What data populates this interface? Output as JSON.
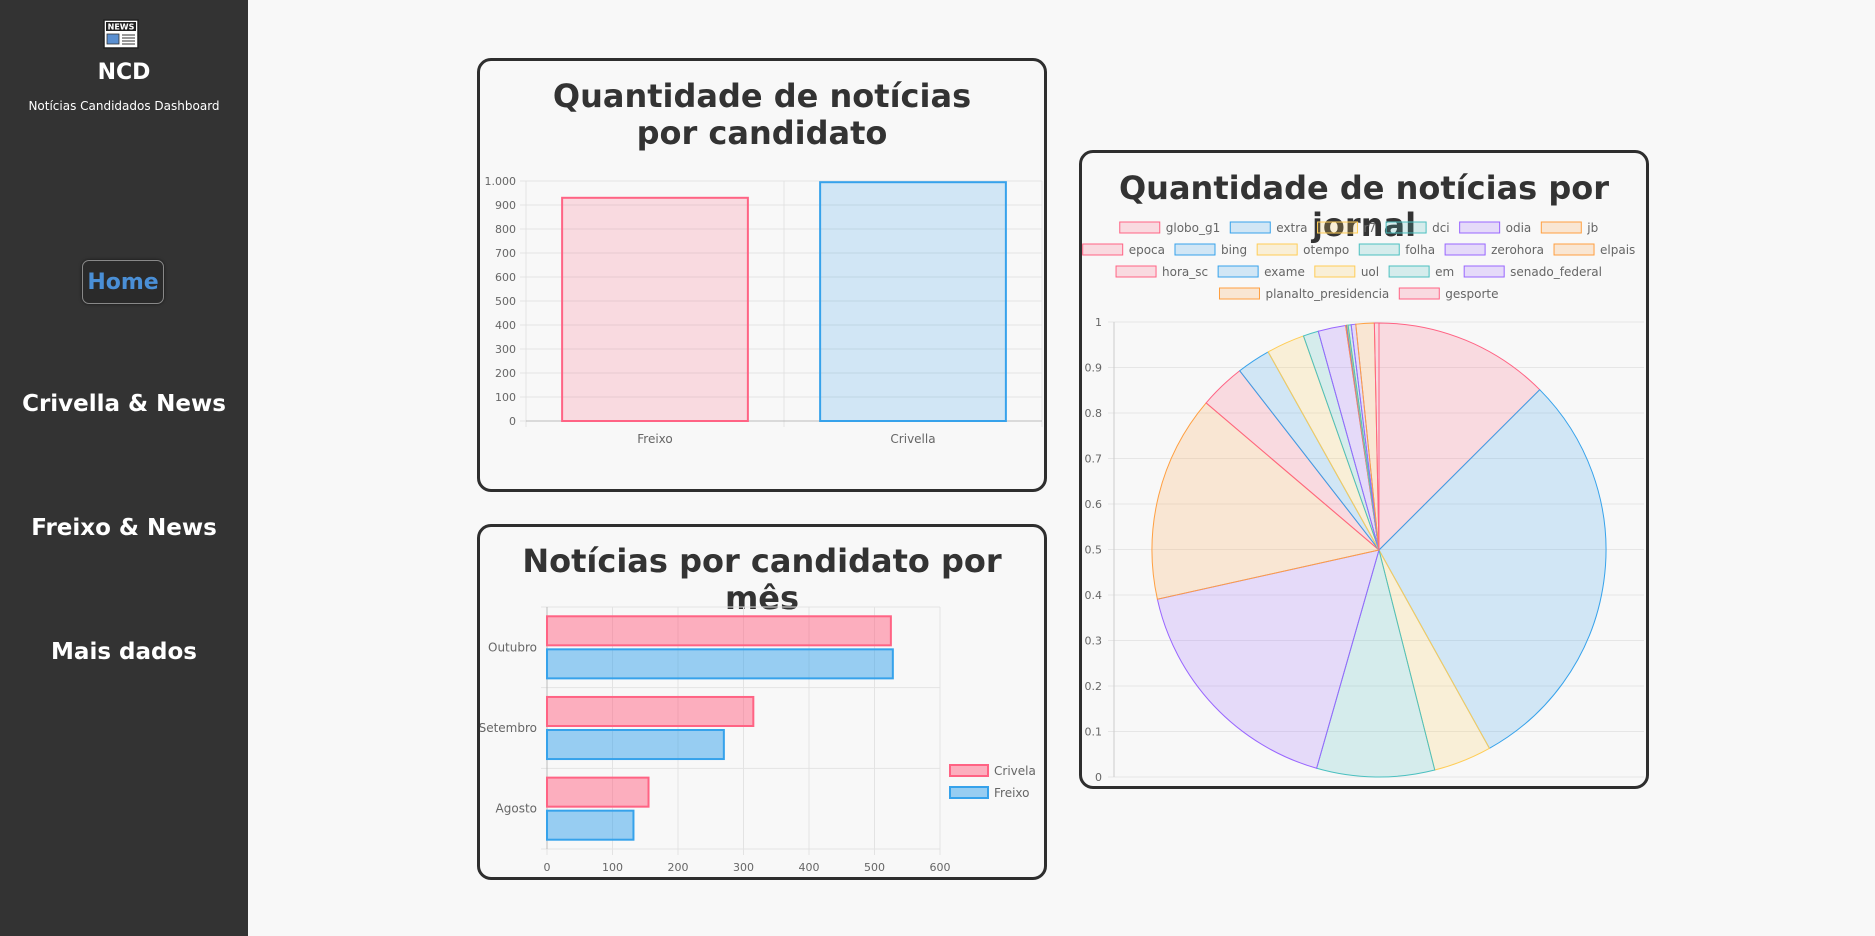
{
  "sidebar": {
    "brand": "NCD",
    "subtitle": "Notícias Candidados Dashboard",
    "nav": {
      "home": "Home",
      "crivella": "Crivella & News",
      "freixo": "Freixo & News",
      "mais": "Mais dados"
    },
    "accent": "#4a8fd6"
  },
  "cards": {
    "bar_title": "Quantidade de notícias por candidato",
    "hbar_title": "Notícias por candidato por mês",
    "pie_title": "Quantidade de notícias por jornal"
  },
  "chart_data": [
    {
      "type": "bar",
      "title": "Quantidade de notícias por candidato",
      "categories": [
        "Freixo",
        "Crivella"
      ],
      "values": [
        930,
        995
      ],
      "ylim": [
        0,
        1000
      ],
      "yticks": [
        "0",
        "100",
        "200",
        "300",
        "400",
        "500",
        "600",
        "700",
        "800",
        "900",
        "1.000"
      ],
      "colors": [
        "#ff6384",
        "#36a2eb"
      ],
      "grid": true
    },
    {
      "type": "bar",
      "orientation": "horizontal",
      "title": "Notícias por candidato por mês",
      "categories": [
        "Outubro",
        "Setembro",
        "Agosto"
      ],
      "series": [
        {
          "name": "Crivela",
          "values": [
            525,
            315,
            155
          ],
          "color": "#ff6384"
        },
        {
          "name": "Freixo",
          "values": [
            528,
            270,
            132
          ],
          "color": "#36a2eb"
        }
      ],
      "xlim": [
        0,
        600
      ],
      "xticks": [
        "0",
        "100",
        "200",
        "300",
        "400",
        "500",
        "600"
      ],
      "legend": "right",
      "grid": true
    },
    {
      "type": "pie",
      "title": "Quantidade de notícias por jornal",
      "labels": [
        "globo_g1",
        "extra",
        "r7",
        "dci",
        "odia",
        "jb",
        "epoca",
        "bing",
        "otempo",
        "folha",
        "zerohora",
        "elpais",
        "hora_sc",
        "exame",
        "uol",
        "em",
        "senado_federal",
        "planalto_presidencia",
        "gesporte"
      ],
      "values": [
        115,
        270,
        38,
        77,
        157,
        135,
        30,
        22,
        25,
        10,
        18,
        0.4,
        0.4,
        0.4,
        0.4,
        2,
        3,
        12,
        3
      ],
      "colors": [
        "#ff6384",
        "#36a2eb",
        "#ffcd56",
        "#4bc0c0",
        "#9966ff",
        "#ff9f40",
        "#ff6384",
        "#36a2eb",
        "#ffcd56",
        "#4bc0c0",
        "#9966ff",
        "#ff9f40",
        "#ff6384",
        "#36a2eb",
        "#ffcd56",
        "#4bc0c0",
        "#9966ff",
        "#ff9f40",
        "#ff6384"
      ],
      "yticks": [
        "0",
        "0.1",
        "0.2",
        "0.3",
        "0.4",
        "0.5",
        "0.6",
        "0.7",
        "0.8",
        "0.9",
        "1"
      ],
      "legend": "top",
      "grid": true
    }
  ]
}
